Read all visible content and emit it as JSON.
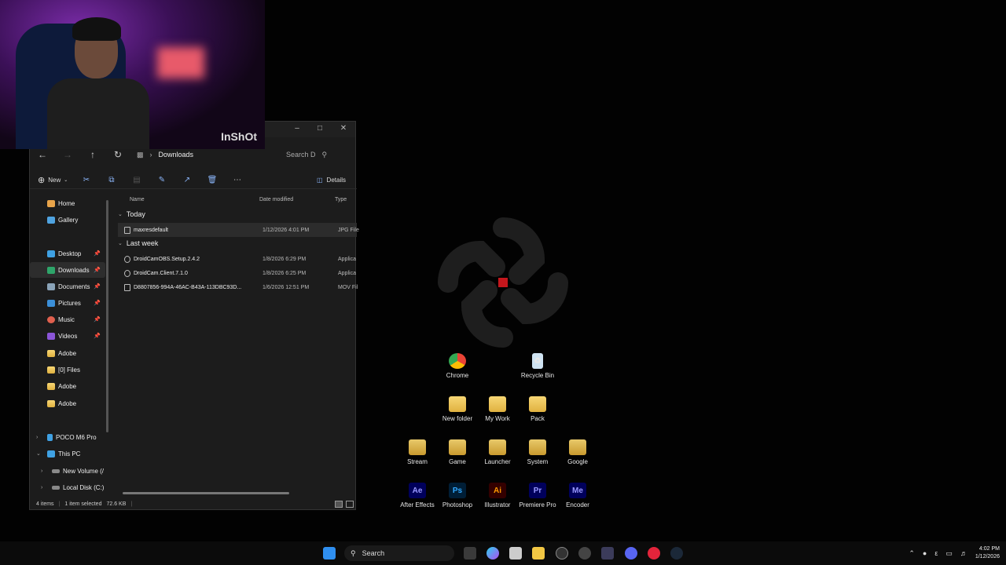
{
  "explorer": {
    "address_folder": "Downloads",
    "search_placeholder": "Search D",
    "toolbar": {
      "new_label": "New",
      "details_label": "Details"
    },
    "sidebar": {
      "home": "Home",
      "gallery": "Gallery",
      "desktop": "Desktop",
      "downloads": "Downloads",
      "documents": "Documents",
      "pictures": "Pictures",
      "music": "Music",
      "videos": "Videos",
      "adobe1": "Adobe",
      "files0": "[0] Files",
      "adobe2": "Adobe",
      "adobe3": "Adobe",
      "phone": "POCO M6 Pro",
      "this_pc": "This PC",
      "new_volume": "New Volume (/",
      "local_disk": "Local Disk (C:)"
    },
    "columns": {
      "name": "Name",
      "date": "Date modified",
      "type": "Type"
    },
    "groups": {
      "today": "Today",
      "last_week": "Last week"
    },
    "files": [
      {
        "name": "maxresdefault",
        "date": "1/12/2026 4:01 PM",
        "type": "JPG File"
      },
      {
        "name": "DroidCamOBS.Setup.2.4.2",
        "date": "1/8/2026 6:29 PM",
        "type": "Applica"
      },
      {
        "name": "DroidCam.Client.7.1.0",
        "date": "1/8/2026 6:25 PM",
        "type": "Applica"
      },
      {
        "name": "D8807856-994A-46AC-B43A-113DBC93D...",
        "date": "1/6/2026 12:51 PM",
        "type": "MOV Fil"
      }
    ],
    "status": {
      "items": "4 items",
      "selected": "1 item selected",
      "size": "72.6 KB"
    }
  },
  "webcam": {
    "watermark": "InShOt"
  },
  "desktop_icons": {
    "chrome": "Chrome",
    "recycle": "Recycle Bin",
    "new_folder": "New folder",
    "my_work": "My Work",
    "pack": "Pack",
    "stream": "Stream",
    "game": "Game",
    "launcher": "Launcher",
    "system": "System",
    "google": "Google",
    "ae": "After Effects",
    "ps": "Photoshop",
    "ai": "Illustrator",
    "pr": "Premiere Pro",
    "me": "Encoder"
  },
  "app_badges": {
    "ae": "Ae",
    "ps": "Ps",
    "ai": "Ai",
    "pr": "Pr",
    "me": "Me"
  },
  "taskbar": {
    "search_label": "Search",
    "time": "4:02 PM",
    "date": "1/12/2026",
    "ime": "ε"
  }
}
